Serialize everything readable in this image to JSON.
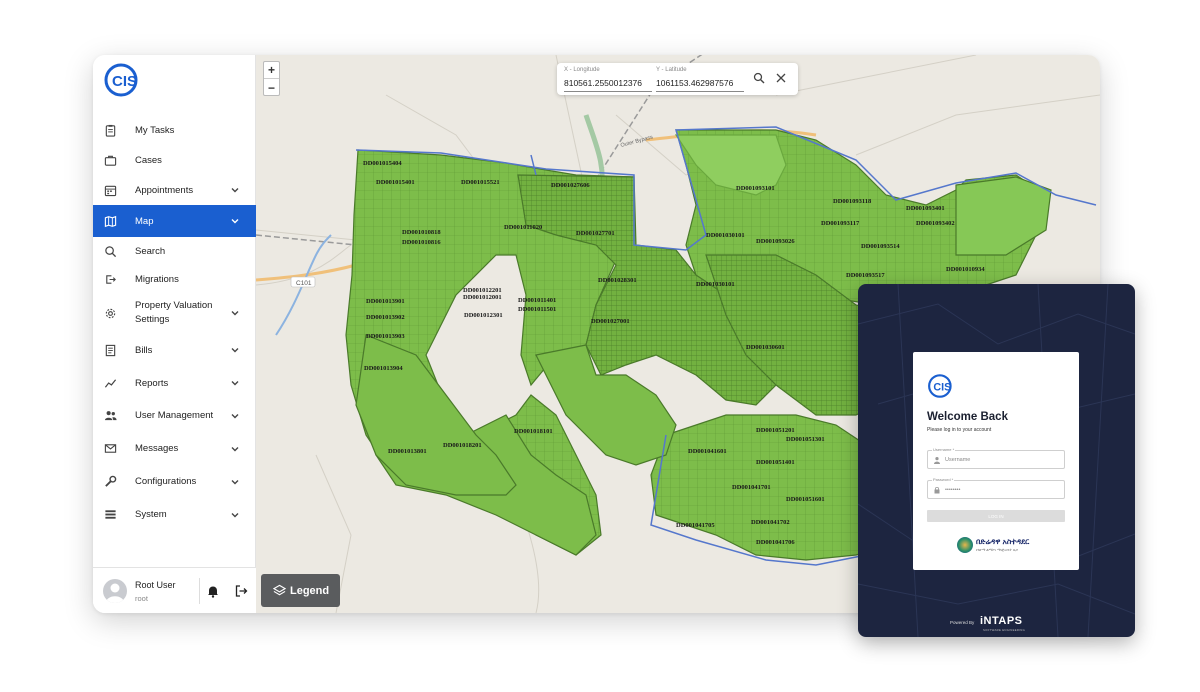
{
  "app": {
    "logo_text": "CIS"
  },
  "sidebar": {
    "items": [
      {
        "label": "My Tasks",
        "icon": "clipboard-icon",
        "has_chevron": false
      },
      {
        "label": "Cases",
        "icon": "briefcase-icon",
        "has_chevron": false
      },
      {
        "label": "Appointments",
        "icon": "calendar-icon",
        "has_chevron": true
      },
      {
        "label": "Map",
        "icon": "map-icon",
        "has_chevron": true,
        "active": true
      },
      {
        "label": "Search",
        "icon": "search-icon",
        "has_chevron": false
      },
      {
        "label": "Migrations",
        "icon": "migrations-icon",
        "has_chevron": false
      },
      {
        "label": "Property Valuation Settings",
        "icon": "gear-icon",
        "has_chevron": true
      },
      {
        "label": "Bills",
        "icon": "bill-icon",
        "has_chevron": true
      },
      {
        "label": "Reports",
        "icon": "chart-line-icon",
        "has_chevron": true
      },
      {
        "label": "User Management",
        "icon": "users-icon",
        "has_chevron": true
      },
      {
        "label": "Messages",
        "icon": "mail-icon",
        "has_chevron": true
      },
      {
        "label": "Configurations",
        "icon": "wrench-icon",
        "has_chevron": true
      },
      {
        "label": "System",
        "icon": "list-icon",
        "has_chevron": true
      }
    ],
    "user": {
      "name": "Root User",
      "role": "root"
    }
  },
  "map": {
    "zoom_in": "+",
    "zoom_out": "−",
    "coords": {
      "x_label": "X - Longitude",
      "x_value": "810561.2550012376",
      "y_label": "Y - Latitude",
      "y_value": "1061153.462987576"
    },
    "legend_label": "Legend",
    "road_labels": [
      "C101",
      "Outer Bypass"
    ],
    "parcel_labels": [
      "DD001015404",
      "DD001015401",
      "DD001015521",
      "DD001027606",
      "DD001093101",
      "DD001093118",
      "DD001093401",
      "DD001093402",
      "DD001093117",
      "DD001010818",
      "DD001010816",
      "DD001011020",
      "DD001027701",
      "DD001030101",
      "DD001093026",
      "DD001093514",
      "DD001093517",
      "DD001010934",
      "DD001028301",
      "DD001012201",
      "DD001012001",
      "DD001011401",
      "DD001011501",
      "DD001030101",
      "DD001013901",
      "DD001013902",
      "DD001012301",
      "DD001027001",
      "DD001013903",
      "DD001030601",
      "DD001013904",
      "DD001018101",
      "DD001018201",
      "DD001013801",
      "DD001051201",
      "DD001051301",
      "DD001041601",
      "DD001051401",
      "DD001041701",
      "DD001051601",
      "DD001041702",
      "DD001041705",
      "DD001041706"
    ]
  },
  "login": {
    "logo_text": "CIS",
    "title": "Welcome Back",
    "subtitle": "Please log in to your account",
    "username_label": "Username *",
    "username_placeholder": "Username",
    "password_label": "Password *",
    "password_placeholder": "••••••••",
    "button_label": "LOG IN",
    "brand_text": "በድሬዳዋ አስተዳደር",
    "brand_sub": "የከተማ ልማትና ማኔጅመንት ቢሮ",
    "powered_by": "Powered By",
    "company": "iNTAPS",
    "company_sub": "SOFTWARE ENGINEERING"
  },
  "colors": {
    "accent": "#1a5fd0",
    "parcel_fill": "#7dbd4a",
    "parcel_stroke": "#4a7a2a",
    "login_bg": "#1d2540"
  }
}
